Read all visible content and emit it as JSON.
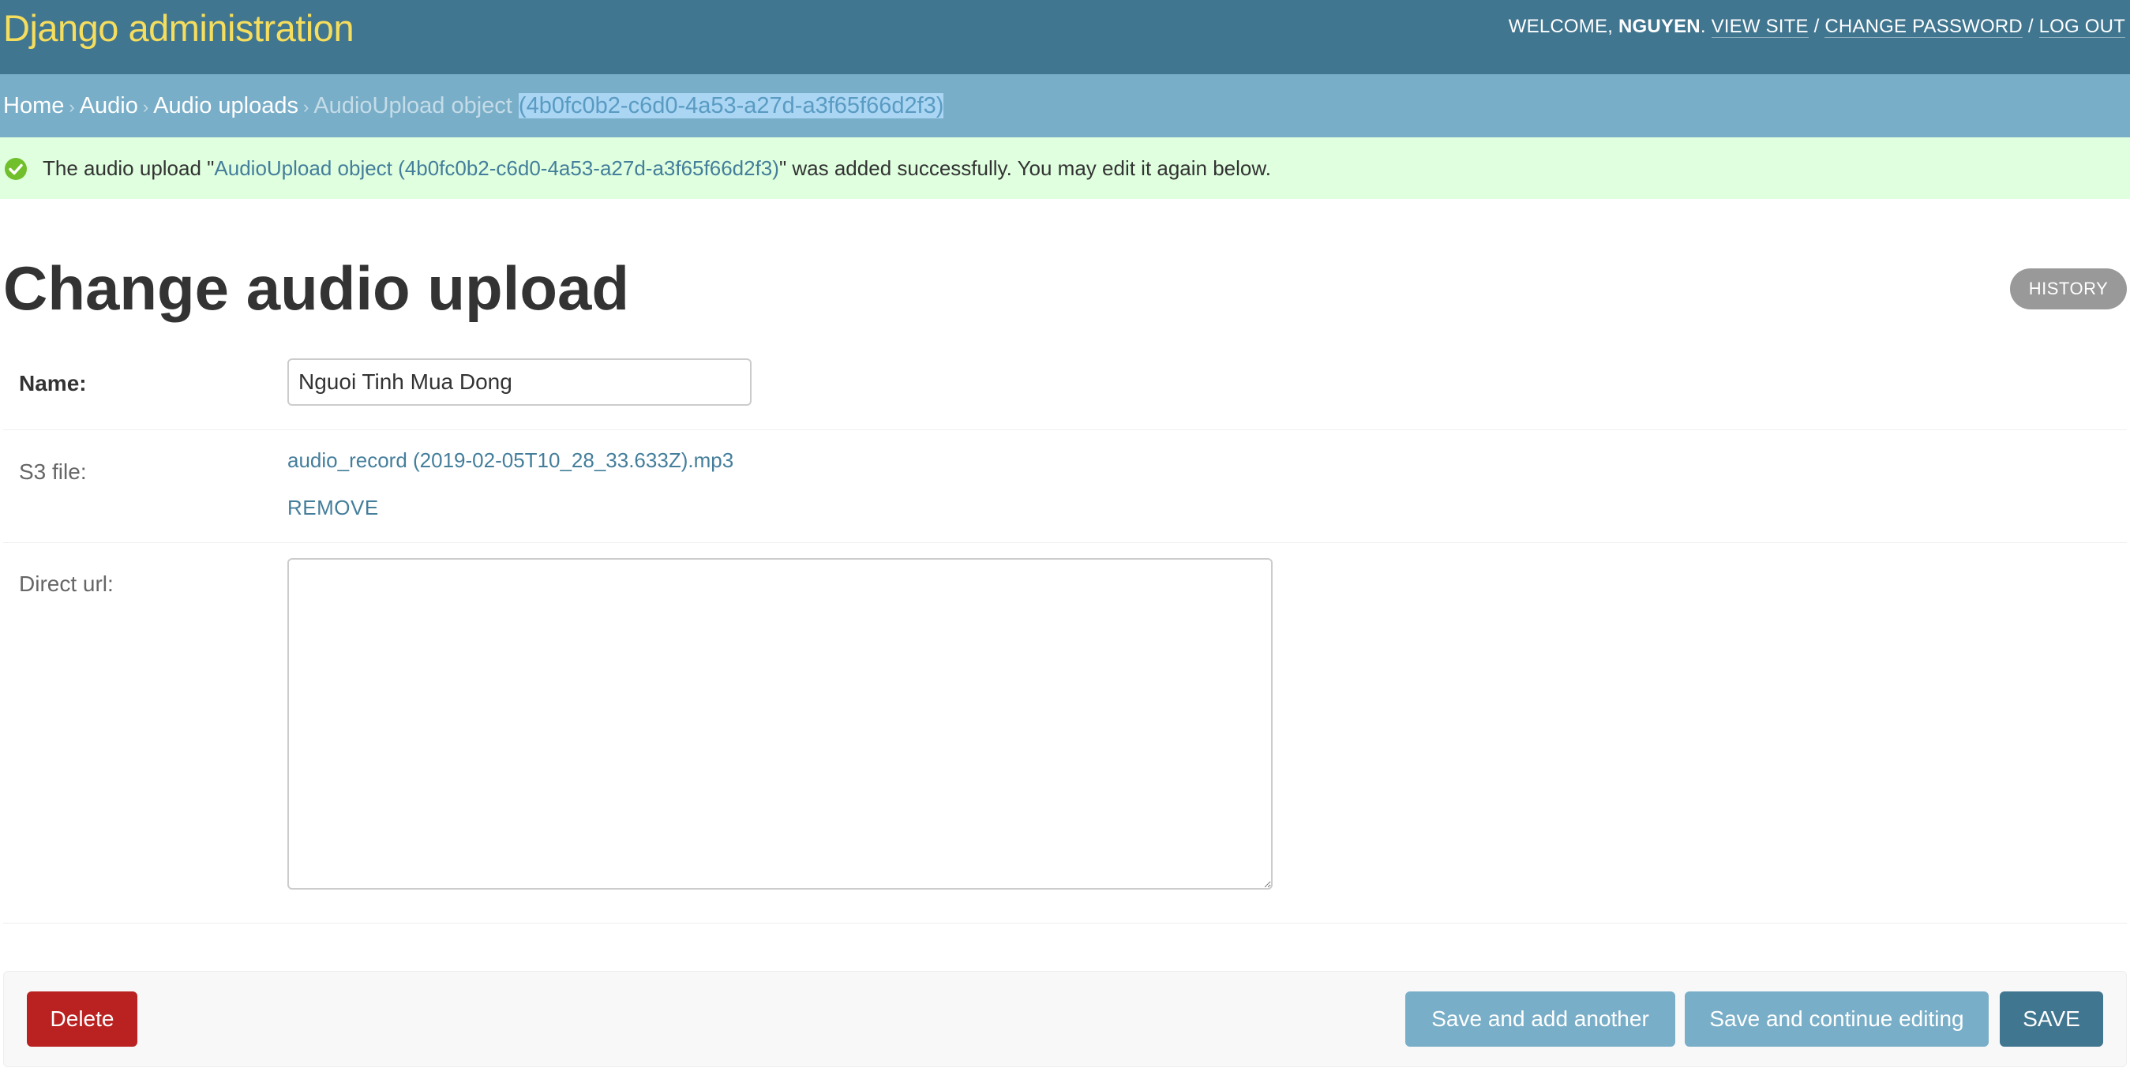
{
  "header": {
    "site_name": "Django administration",
    "welcome": "WELCOME,",
    "username": "NGUYEN",
    "view_site": "VIEW SITE",
    "change_password": "CHANGE PASSWORD",
    "log_out": "LOG OUT",
    "separator": "/",
    "colors": {
      "background": "#417690",
      "site_name": "#f5dd5d"
    }
  },
  "breadcrumbs": {
    "home": "Home",
    "app": "Audio",
    "model": "Audio uploads",
    "current_prefix": "AudioUpload object",
    "current_id": "(4b0fc0b2-c6d0-4a53-a27d-a3f65f66d2f3)",
    "separator": "›"
  },
  "message": {
    "icon": "success-check-icon",
    "prefix": "The audio upload \"",
    "object_link": "AudioUpload object (4b0fc0b2-c6d0-4a53-a27d-a3f65f66d2f3)",
    "suffix": "\" was added successfully. You may edit it again below."
  },
  "page": {
    "title": "Change audio upload",
    "history": "HISTORY"
  },
  "form": {
    "name": {
      "label": "Name:",
      "value": "Nguoi Tinh Mua Dong"
    },
    "s3_file": {
      "label": "S3 file:",
      "file": "audio_record (2019-02-05T10_28_33.633Z).mp3",
      "remove": "REMOVE"
    },
    "direct_url": {
      "label": "Direct url:",
      "value": ""
    }
  },
  "submit_row": {
    "delete": "Delete",
    "save_add_another": "Save and add another",
    "save_continue": "Save and continue editing",
    "save": "SAVE",
    "colors": {
      "delete": "#ba2121",
      "secondary": "#79aec8",
      "primary": "#417690"
    }
  }
}
